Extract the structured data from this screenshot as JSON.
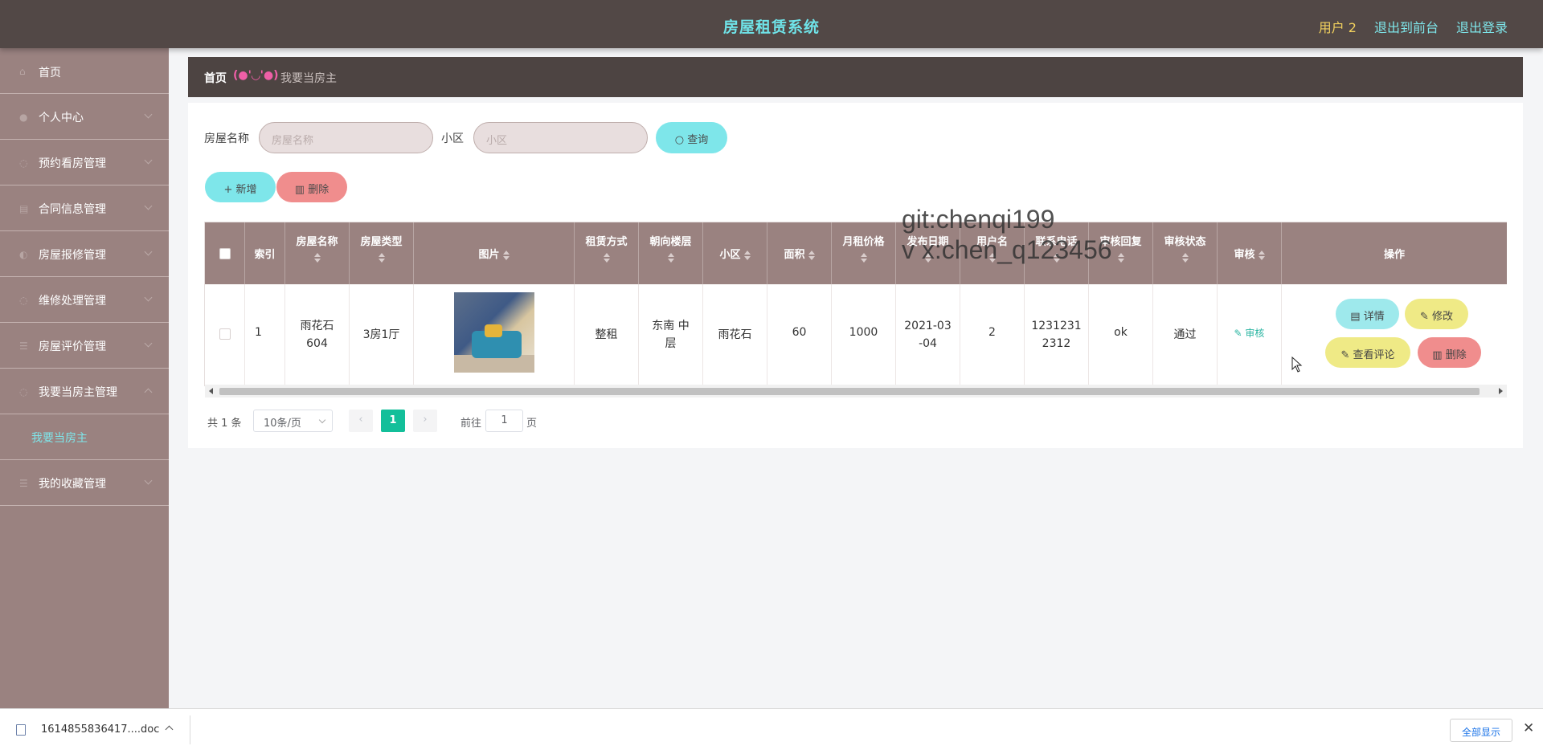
{
  "header": {
    "title": "房屋租赁系统",
    "user": "用户 2",
    "to_front": "退出到前台",
    "logout": "退出登录"
  },
  "sidebar": {
    "items": [
      {
        "label": "首页",
        "icon": "home-icon"
      },
      {
        "label": "个人中心",
        "icon": "user-icon"
      },
      {
        "label": "预约看房管理",
        "icon": "calendar-icon"
      },
      {
        "label": "合同信息管理",
        "icon": "document-icon"
      },
      {
        "label": "房屋报修管理",
        "icon": "wrench-icon"
      },
      {
        "label": "维修处理管理",
        "icon": "tools-icon"
      },
      {
        "label": "房屋评价管理",
        "icon": "list-icon"
      },
      {
        "label": "我要当房主管理",
        "icon": "house-icon"
      }
    ],
    "sub_item": "我要当房主",
    "last_item": "我的收藏管理"
  },
  "breadcrumb": {
    "home": "首页",
    "separator": "(●'◡'●)",
    "current": "我要当房主"
  },
  "search": {
    "name_label": "房屋名称",
    "name_placeholder": "房屋名称",
    "community_label": "小区",
    "community_placeholder": "小区",
    "query_button": "查询"
  },
  "actions": {
    "add": "新增",
    "delete": "删除"
  },
  "table": {
    "headers": {
      "index": "索引",
      "name": "房屋名称",
      "type": "房屋类型",
      "image": "图片",
      "rent_mode": "租赁方式",
      "orientation": "朝向楼层",
      "community": "小区",
      "area": "面积",
      "price": "月租价格",
      "date": "发布日期",
      "username": "用户名",
      "phone": "联系电话",
      "reply": "审核回复",
      "status": "审核状态",
      "audit": "审核",
      "ops": "操作"
    },
    "rows": [
      {
        "index": "1",
        "name": "雨花石604",
        "type": "3房1厅",
        "rent_mode": "整租",
        "orientation": "东南 中层",
        "community": "雨花石",
        "area": "60",
        "price": "1000",
        "date": "2021-03-04",
        "username": "2",
        "phone": "12312312312",
        "reply": "ok",
        "status": "通过",
        "audit_link": "审核",
        "detail": "详情",
        "edit": "修改",
        "reviews": "查看评论",
        "delete": "删除"
      }
    ]
  },
  "pagination": {
    "total": "共 1 条",
    "page_size": "10条/页",
    "current_page": "1",
    "goto_label": "前往",
    "goto_value": "1",
    "page_suffix": "页"
  },
  "watermark": {
    "line1": "git:chenqi199",
    "line2": "v x:chen_q123456"
  },
  "download_bar": {
    "file_name": "1614855836417....doc",
    "show_all": "全部显示"
  },
  "colors": {
    "header_bg": "#524846",
    "sidebar_bg": "#9a8280",
    "accent_cyan": "#7ee6ea",
    "accent_yellow": "#efea86",
    "accent_red": "#f08d8d",
    "page_active": "#13bf9a"
  }
}
